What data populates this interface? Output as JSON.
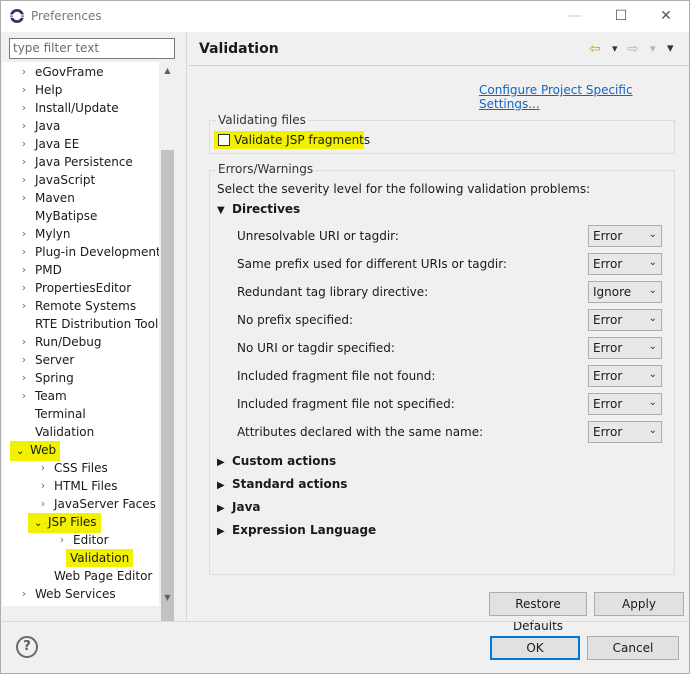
{
  "window": {
    "title": "Preferences",
    "minimize_symbol": "—",
    "maximize_symbol": "☐",
    "close_symbol": "✕"
  },
  "sidebar": {
    "filter_placeholder": "type filter text",
    "items": [
      {
        "label": "eGovFrame",
        "expander": "›",
        "highlighted": false
      },
      {
        "label": "Help",
        "expander": "›",
        "highlighted": false
      },
      {
        "label": "Install/Update",
        "expander": "›",
        "highlighted": false
      },
      {
        "label": "Java",
        "expander": "›",
        "highlighted": false
      },
      {
        "label": "Java EE",
        "expander": "›",
        "highlighted": false
      },
      {
        "label": "Java Persistence",
        "expander": "›",
        "highlighted": false
      },
      {
        "label": "JavaScript",
        "expander": "›",
        "highlighted": false
      },
      {
        "label": "Maven",
        "expander": "›",
        "highlighted": false
      },
      {
        "label": "MyBatipse",
        "expander": "",
        "highlighted": false
      },
      {
        "label": "Mylyn",
        "expander": "›",
        "highlighted": false
      },
      {
        "label": "Plug-in Development",
        "expander": "›",
        "highlighted": false
      },
      {
        "label": "PMD",
        "expander": "›",
        "highlighted": false
      },
      {
        "label": "PropertiesEditor",
        "expander": "›",
        "highlighted": false
      },
      {
        "label": "Remote Systems",
        "expander": "›",
        "highlighted": false
      },
      {
        "label": "RTE Distribution Tool",
        "expander": "",
        "highlighted": false
      },
      {
        "label": "Run/Debug",
        "expander": "›",
        "highlighted": false
      },
      {
        "label": "Server",
        "expander": "›",
        "highlighted": false
      },
      {
        "label": "Spring",
        "expander": "›",
        "highlighted": false
      },
      {
        "label": "Team",
        "expander": "›",
        "highlighted": false
      },
      {
        "label": "Terminal",
        "expander": "",
        "highlighted": false
      },
      {
        "label": "Validation",
        "expander": "",
        "highlighted": false
      },
      {
        "label": "Web",
        "expander": "⌄",
        "highlighted": true
      },
      {
        "label": "CSS Files",
        "expander": "›",
        "highlighted": false
      },
      {
        "label": "HTML Files",
        "expander": "›",
        "highlighted": false
      },
      {
        "label": "JavaServer Faces Tools",
        "expander": "›",
        "highlighted": false
      },
      {
        "label": "JSP Files",
        "expander": "⌄",
        "highlighted": true
      },
      {
        "label": "Editor",
        "expander": "›",
        "highlighted": false
      },
      {
        "label": "Validation",
        "expander": "",
        "highlighted": true
      },
      {
        "label": "Web Page Editor",
        "expander": "",
        "highlighted": false
      },
      {
        "label": "Web Services",
        "expander": "›",
        "highlighted": false
      }
    ]
  },
  "main": {
    "title": "Validation",
    "nav": {
      "back": "⇦",
      "back_menu": "▾",
      "forward": "⇨",
      "forward_menu": "▾",
      "view_menu": "▾"
    },
    "config_link": "Configure Project Specific Settings...",
    "validating_files": {
      "group_label": "Validating files",
      "checkbox_label": "Validate JSP fragments",
      "checked": false
    },
    "errors_warnings": {
      "group_label": "Errors/Warnings",
      "description": "Select the severity level for the following validation problems:",
      "directives_label": "Directives",
      "directives_toggle": "▼",
      "settings": [
        {
          "label": "Unresolvable URI or tagdir:",
          "value": "Error"
        },
        {
          "label": "Same prefix used for different URIs or tagdir:",
          "value": "Error"
        },
        {
          "label": "Redundant tag library directive:",
          "value": "Ignore"
        },
        {
          "label": "No prefix specified:",
          "value": "Error"
        },
        {
          "label": "No URI or tagdir specified:",
          "value": "Error"
        },
        {
          "label": "Included fragment file not found:",
          "value": "Error"
        },
        {
          "label": "Included fragment file not specified:",
          "value": "Error"
        },
        {
          "label": "Attributes declared with the same name:",
          "value": "Error"
        }
      ],
      "collapsed_sections": [
        {
          "label": "Custom actions",
          "toggle": "▶"
        },
        {
          "label": "Standard actions",
          "toggle": "▶"
        },
        {
          "label": "Java",
          "toggle": "▶"
        },
        {
          "label": "Expression Language",
          "toggle": "▶"
        }
      ]
    },
    "restore_defaults_label": "Restore Defaults",
    "apply_label": "Apply"
  },
  "footer": {
    "help_symbol": "?",
    "ok_label": "OK",
    "cancel_label": "Cancel"
  },
  "colors": {
    "highlight": "#f2f200",
    "link": "#1565c0",
    "primary_border": "#0078d7"
  }
}
